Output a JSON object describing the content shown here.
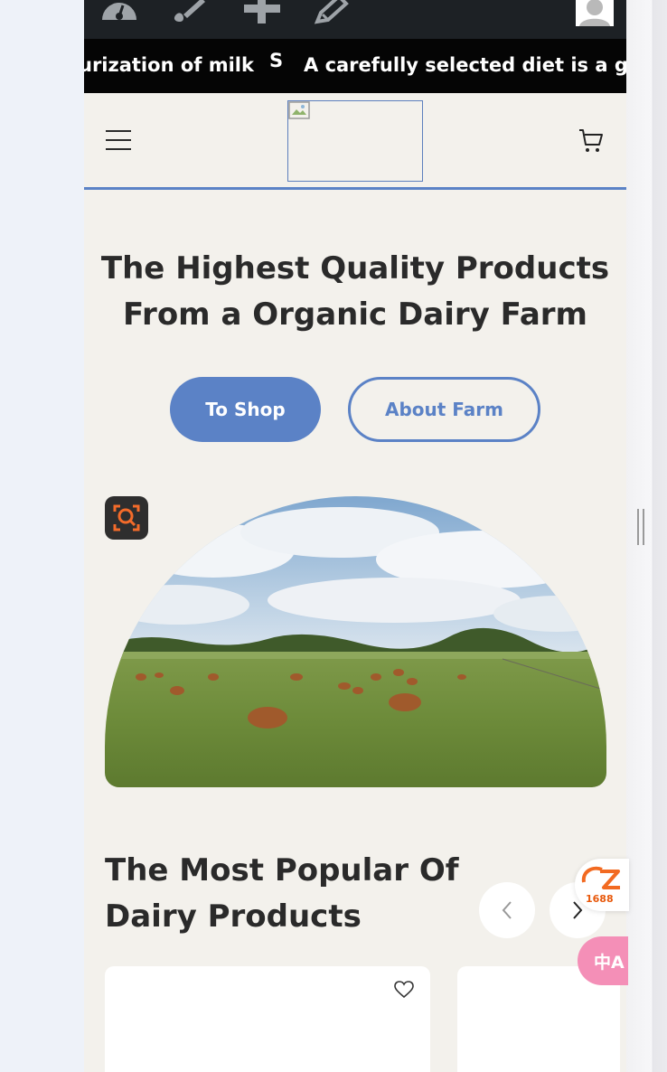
{
  "marquee": {
    "items": [
      "urization of milk",
      "S",
      "A carefully selected diet is a gua"
    ]
  },
  "header": {
    "logo_alt": "",
    "menu_icon": "hamburger-menu-icon",
    "cart_icon": "cart-icon"
  },
  "hero": {
    "title_line1": "The Highest Quality Products",
    "title_line2": "From a Organic Dairy Farm",
    "shop_button": "To Shop",
    "about_button": "About Farm"
  },
  "popular": {
    "title_line1": "The Most Popular Of",
    "title_line2": "Dairy Products"
  },
  "widgets": {
    "alibaba_label": "1688",
    "translate_label": "中A"
  },
  "colors": {
    "accent": "#5b82c6",
    "page_bg": "#f3f1ec",
    "toolbar_bg": "#1d2125",
    "marquee_bg": "#050505"
  }
}
